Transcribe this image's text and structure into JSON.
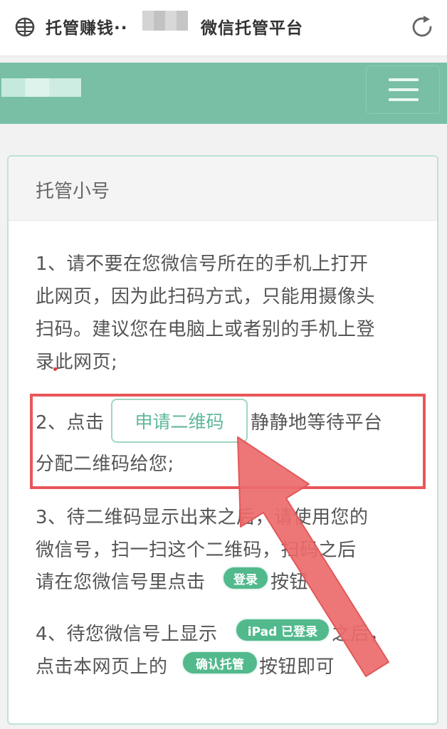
{
  "browser": {
    "title": "托管赚钱··",
    "subtitle": "微信托管平台",
    "icons": [
      "globe-icon",
      "refresh-icon"
    ]
  },
  "header": {
    "menu_icon": "hamburger-menu-icon",
    "color": "#78bfa5"
  },
  "card": {
    "title": "托管小号",
    "step1": [
      "1、请不要在您微信号所在的手机上打开",
      "此网页，因为此扫码方式，只能用摄像头",
      "扫码。建议您在电脑上或者别的手机上登",
      "录此网页;"
    ],
    "step2": {
      "prefix": "2、点击",
      "button_label": "申请二维码",
      "suffix": "静静地等待平台",
      "line2": "分配二维码给您;"
    },
    "step3": {
      "line1": "3、待二维码显示出来之后，请使用您的",
      "line2": "微信号，扫一扫这个二维码，扫码之后",
      "line3_prefix": "请在您微信号里点击",
      "login_badge": "登录",
      "line3_suffix": "按钮"
    },
    "step4": {
      "line1_prefix": "4、待您微信号上显示",
      "ipad_badge": "iPad 已登录",
      "line1_suffix": "之后，",
      "line2_prefix": "点击本网页上的",
      "confirm_badge": "确认托管",
      "line2_suffix": "按钮即可"
    }
  },
  "colors": {
    "accent_green": "#52b98d",
    "highlight_red": "#e8575a",
    "arrow_red": "#ec6b6b"
  }
}
